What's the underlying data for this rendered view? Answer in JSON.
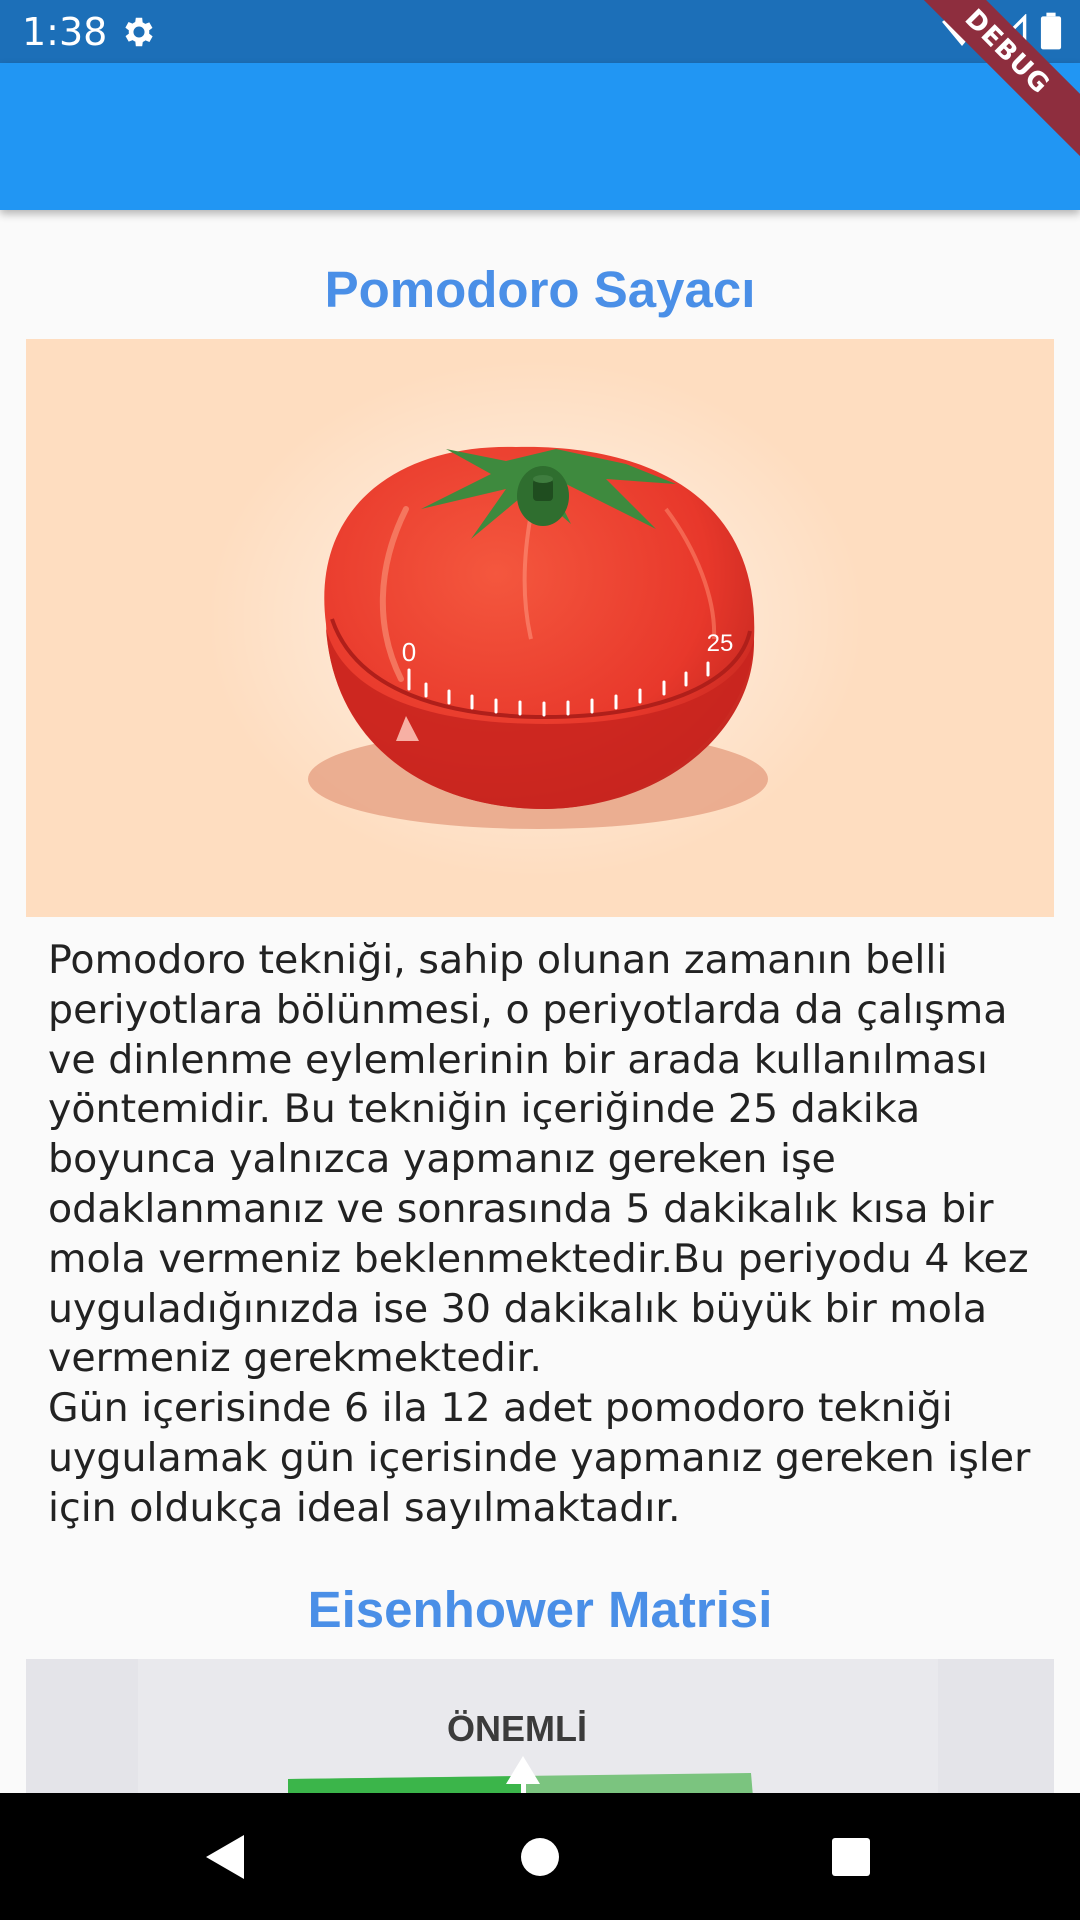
{
  "status_bar": {
    "time": "1:38",
    "icons": [
      "settings-icon",
      "wifi-icon",
      "signal-icon",
      "battery-icon"
    ]
  },
  "debug_banner": "DEBUG",
  "colors": {
    "status_bar": "#1C6FB8",
    "app_bar": "#2196F3",
    "section_title": "#4A8FE7",
    "background": "#FAFAFA"
  },
  "sections": [
    {
      "title": "Pomodoro Sayacı",
      "image_icon": "tomato-timer-icon",
      "dial_labels": [
        "0",
        "25"
      ],
      "paragraphs": [
        "Pomodoro tekniği, sahip olunan zamanın belli periyotlara bölünmesi, o periyotlarda da çalışma ve dinlenme eylemlerinin bir arada kullanılması yöntemidir. Bu tekniğin içeriğinde 25 dakika boyunca yalnızca yapmanız gereken işe odaklanmanız ve sonrasında 5 dakikalık kısa bir mola vermeniz beklenmektedir.Bu periyodu 4 kez uyguladığınızda ise 30 dakikalık büyük bir mola vermeniz gerekmektedir.",
        "Gün içerisinde 6 ila 12 adet pomodoro tekniği uygulamak gün içerisinde yapmanız gereken işler için oldukça ideal sayılmaktadır."
      ]
    },
    {
      "title": "Eisenhower Matrisi",
      "image_label": "ÖNEMLİ"
    }
  ],
  "nav_bar": {
    "icons": [
      "back-icon",
      "home-icon",
      "recents-icon"
    ]
  }
}
